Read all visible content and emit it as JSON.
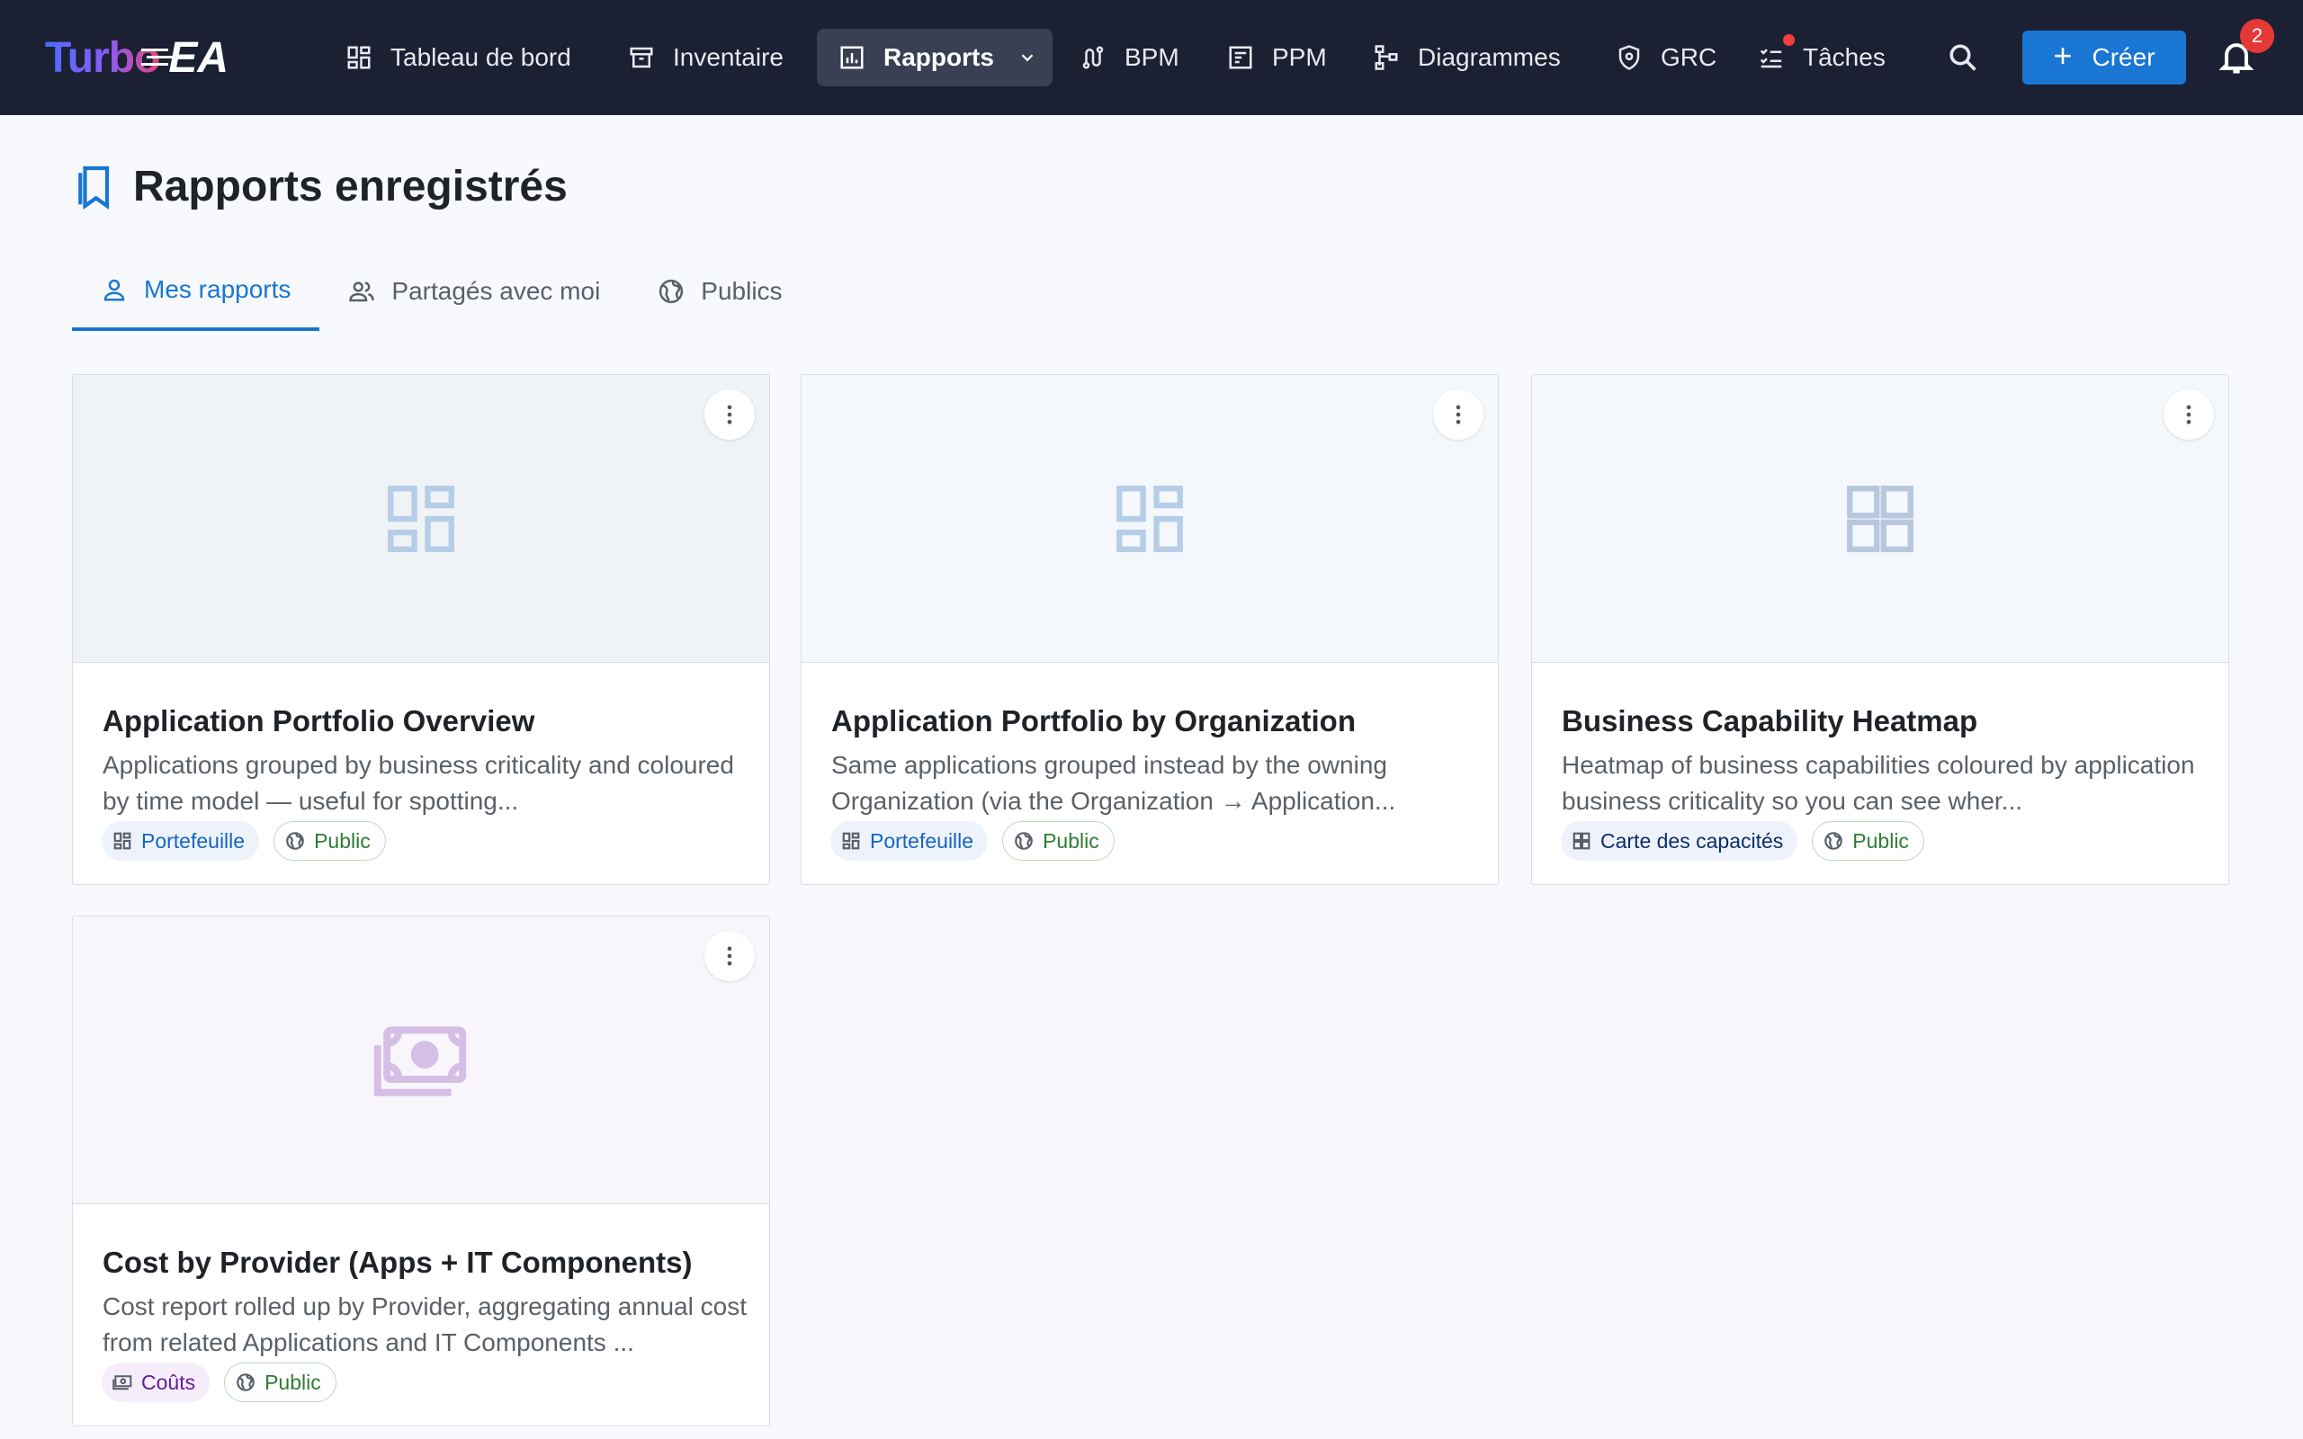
{
  "app": {
    "logo_text_1": "Turbo",
    "logo_text_2": "EA"
  },
  "nav": {
    "items": [
      {
        "label": "Tableau de bord",
        "icon": "dashboard-icon"
      },
      {
        "label": "Inventaire",
        "icon": "archive-icon"
      },
      {
        "label": "Rapports",
        "icon": "bar-chart-icon",
        "active": true
      },
      {
        "label": "BPM",
        "icon": "route-icon"
      },
      {
        "label": "PPM",
        "icon": "project-icon"
      },
      {
        "label": "Diagrammes",
        "icon": "hierarchy-icon"
      },
      {
        "label": "GRC",
        "icon": "shield-icon"
      },
      {
        "label": "Tâches",
        "icon": "checklist-icon",
        "has_notification_dot": true
      }
    ],
    "create_label": "Créer",
    "notification_count": "2"
  },
  "page": {
    "title": "Rapports enregistrés"
  },
  "tabs": [
    {
      "label": "Mes rapports",
      "icon": "person-icon",
      "active": true
    },
    {
      "label": "Partagés avec moi",
      "icon": "people-icon"
    },
    {
      "label": "Publics",
      "icon": "globe-icon"
    }
  ],
  "cards": [
    {
      "title": "Application Portfolio Overview",
      "description": "Applications grouped by business criticality and coloured by time model — useful for spotting...",
      "type_chip": "Portefeuille",
      "visibility_chip": "Public",
      "thumb_icon": "dashboard-icon"
    },
    {
      "title": "Application Portfolio by Organization",
      "description": "Same applications grouped instead by the owning Organization (via the Organization → Application...",
      "type_chip": "Portefeuille",
      "visibility_chip": "Public",
      "thumb_icon": "dashboard-icon"
    },
    {
      "title": "Business Capability Heatmap",
      "description": "Heatmap of business capabilities coloured by application business criticality so you can see wher...",
      "type_chip": "Carte des capacités",
      "visibility_chip": "Public",
      "thumb_icon": "dashboard-icon"
    },
    {
      "title": "Cost by Provider (Apps + IT Components)",
      "description": "Cost report rolled up by Provider, aggregating annual cost from related Applications and IT Components ...",
      "type_chip": "Coûts",
      "visibility_chip": "Public",
      "thumb_icon": "money-icon"
    }
  ],
  "colors": {
    "topbar": "#1b2133",
    "accent": "#1976d2",
    "public_green": "#2e7d32",
    "cost_purple": "#6a1b9a"
  }
}
